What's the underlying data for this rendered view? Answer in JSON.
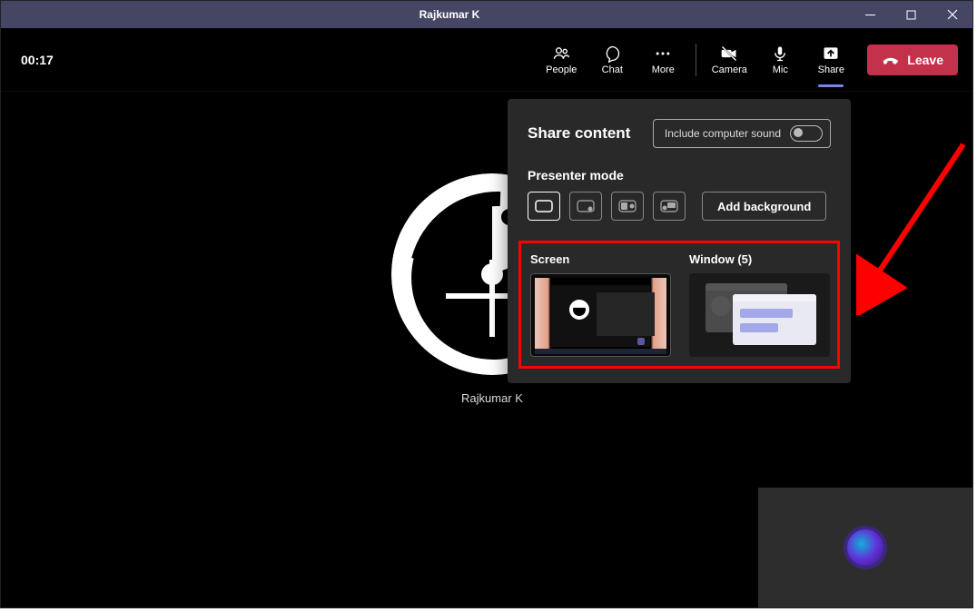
{
  "titlebar": {
    "title": "Rajkumar K"
  },
  "call": {
    "timer": "00:17"
  },
  "actions": {
    "people": "People",
    "chat": "Chat",
    "more": "More",
    "camera": "Camera",
    "mic": "Mic",
    "share": "Share"
  },
  "leave": {
    "label": "Leave"
  },
  "participant": {
    "name": "Rajkumar K"
  },
  "share_panel": {
    "title": "Share content",
    "sound_toggle_label": "Include computer sound",
    "presenter_label": "Presenter mode",
    "add_bg": "Add background",
    "screen_label": "Screen",
    "window_label": "Window (5)"
  }
}
